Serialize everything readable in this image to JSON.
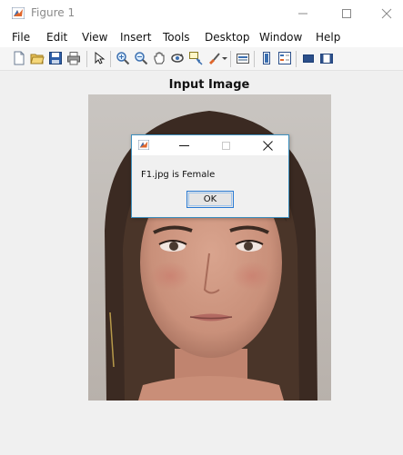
{
  "window": {
    "title": "Figure 1"
  },
  "menu": {
    "items": [
      "File",
      "Edit",
      "View",
      "Insert",
      "Tools",
      "Desktop",
      "Window",
      "Help"
    ]
  },
  "toolbar": {
    "icons": [
      "new-figure-icon",
      "open-file-icon",
      "save-icon",
      "print-icon",
      "pointer-icon",
      "zoom-in-icon",
      "zoom-out-icon",
      "pan-icon",
      "rotate-3d-icon",
      "data-cursor-icon",
      "brush-icon",
      "brush-dropdown-icon",
      "link-plot-icon",
      "colorbar-icon",
      "legend-icon",
      "hide-plot-tools-icon",
      "show-plot-tools-icon"
    ]
  },
  "axes": {
    "title": "Input Image"
  },
  "dialog": {
    "message": "F1.jpg is Female",
    "ok_label": "OK"
  },
  "colors": {
    "dialog_border": "#3c8ebd",
    "ok_border": "#2a7bd4",
    "matlab_icon_orange": "#e0662b"
  }
}
